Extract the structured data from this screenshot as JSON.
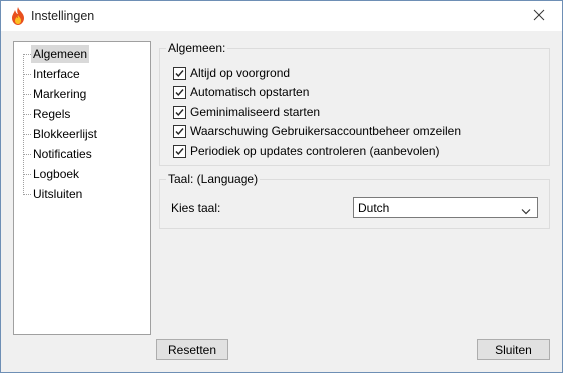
{
  "window": {
    "title": "Instellingen"
  },
  "sidebar": {
    "items": [
      {
        "label": "Algemeen"
      },
      {
        "label": "Interface"
      },
      {
        "label": "Markering"
      },
      {
        "label": "Regels"
      },
      {
        "label": "Blokkeerlijst"
      },
      {
        "label": "Notificaties"
      },
      {
        "label": "Logboek"
      },
      {
        "label": "Uitsluiten"
      }
    ],
    "selected": "Algemeen"
  },
  "general": {
    "title": "Algemeen:",
    "options": [
      {
        "label": "Altijd op voorgrond",
        "checked": true
      },
      {
        "label": "Automatisch opstarten",
        "checked": true
      },
      {
        "label": "Geminimaliseerd starten",
        "checked": true
      },
      {
        "label": "Waarschuwing Gebruikersaccountbeheer omzeilen",
        "checked": true
      },
      {
        "label": "Periodiek op updates controleren (aanbevolen)",
        "checked": true
      }
    ]
  },
  "language": {
    "title": "Taal: (Language)",
    "label": "Kies taal:",
    "selected": "Dutch"
  },
  "buttons": {
    "reset": "Resetten",
    "close": "Sluiten"
  }
}
